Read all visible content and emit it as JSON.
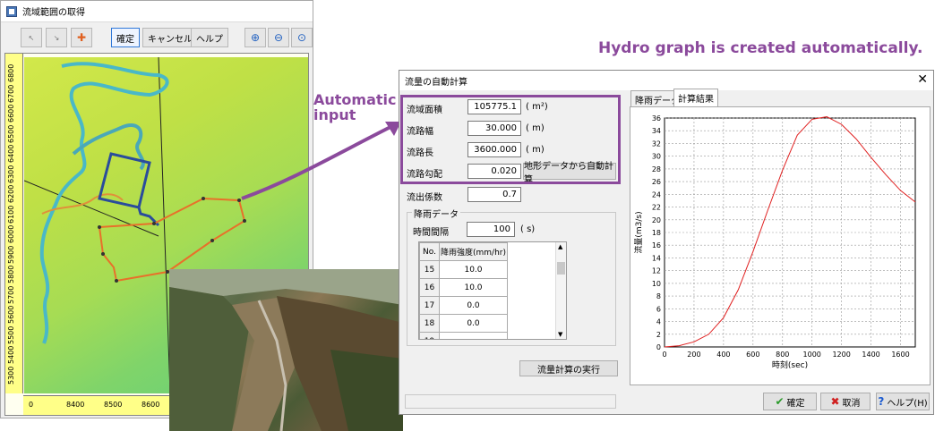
{
  "left_window": {
    "title": "流域範囲の取得",
    "toolbar": {
      "confirm": "確定",
      "cancel": "キャンセル",
      "help": "ヘルプ"
    },
    "vruler_ticks": [
      "6800",
      "6700",
      "6600",
      "6500",
      "6400",
      "6300",
      "6200",
      "6100",
      "6000",
      "5900",
      "5800",
      "5700",
      "5600",
      "5500",
      "5400",
      "5300"
    ],
    "hruler_ticks": [
      "0",
      "8400",
      "8500",
      "8600",
      "8700",
      "8800",
      "8900",
      "9"
    ]
  },
  "annotations": {
    "title": "Hydro graph is created automatically.",
    "auto_line1": "Automatic",
    "auto_line2": "input"
  },
  "dialog": {
    "title": "流量の自動計算",
    "fields": {
      "area_label": "流域面積",
      "area_value": "105775.1",
      "area_unit": "( m²)",
      "width_label": "流路幅",
      "width_value": "30.000",
      "width_unit": "( m)",
      "length_label": "流路長",
      "length_value": "3600.000",
      "length_unit": "( m)",
      "slope_label": "流路勾配",
      "slope_value": "0.020",
      "slope_button": "地形データから自動計算",
      "runoff_label": "流出係数",
      "runoff_value": "0.7"
    },
    "rain_group": {
      "title": "降雨データ",
      "interval_label": "時間間隔",
      "interval_value": "100",
      "interval_unit": "( s)",
      "col_no": "No.",
      "col_intensity": "降雨強度(mm/hr)",
      "rows": [
        {
          "no": "15",
          "value": "10.0"
        },
        {
          "no": "16",
          "value": "10.0"
        },
        {
          "no": "17",
          "value": "0.0"
        },
        {
          "no": "18",
          "value": "0.0"
        },
        {
          "no": "19",
          "value": ""
        }
      ]
    },
    "run_button": "流量計算の実行",
    "tabs": {
      "rain": "降雨データ",
      "result": "計算結果"
    },
    "buttons": {
      "ok": "確定",
      "cancel": "取消",
      "help": "ヘルプ(H)"
    }
  },
  "chart_data": {
    "type": "line",
    "xlabel": "時刻(sec)",
    "ylabel": "流量(m3/s)",
    "xlim": [
      0,
      1700
    ],
    "ylim": [
      0,
      36
    ],
    "xticks": [
      0,
      200,
      400,
      600,
      800,
      1000,
      1200,
      1400,
      1600
    ],
    "yticks": [
      0,
      2,
      4,
      6,
      8,
      10,
      12,
      14,
      16,
      18,
      20,
      22,
      24,
      26,
      28,
      30,
      32,
      34,
      36
    ],
    "grid": true,
    "line_color": "#e02020",
    "series": [
      {
        "x": [
          0,
          100,
          200,
          300,
          400,
          500,
          600,
          700,
          800,
          900,
          1000,
          1100,
          1200,
          1300,
          1400,
          1500,
          1600,
          1700
        ],
        "y": [
          0,
          0.2,
          0.8,
          2.0,
          4.6,
          9.0,
          15.0,
          21.5,
          27.8,
          33.3,
          35.8,
          36.2,
          35.0,
          32.7,
          29.8,
          27.1,
          24.6,
          22.8
        ]
      }
    ]
  }
}
